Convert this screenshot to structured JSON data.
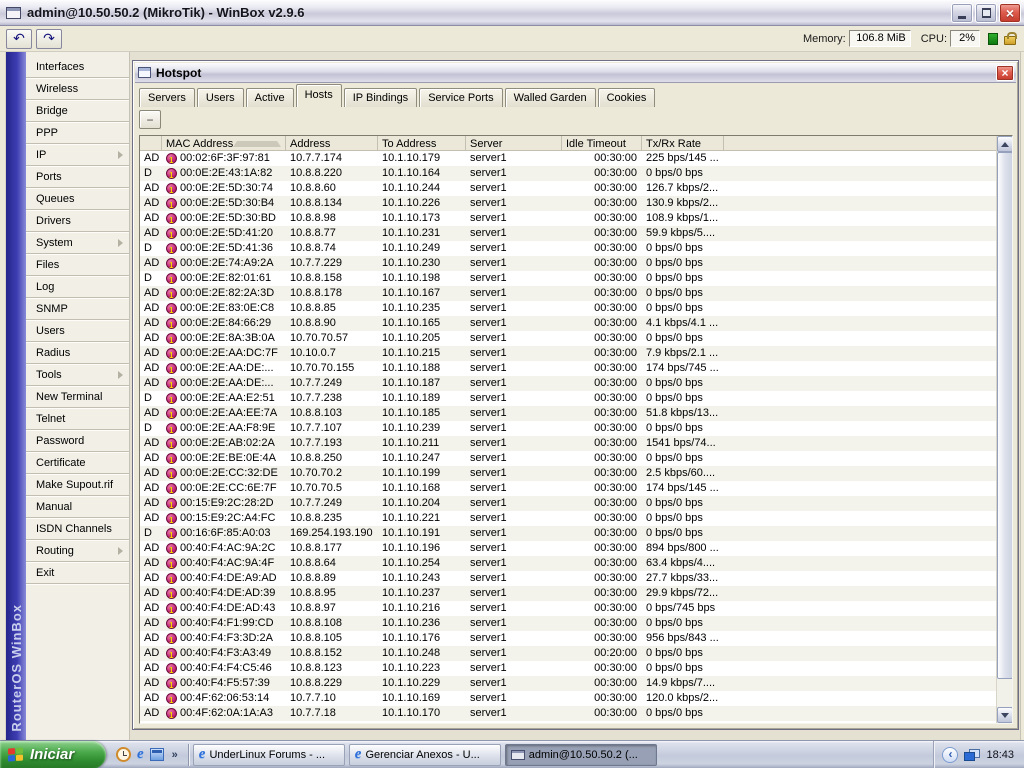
{
  "titlebar": {
    "title": "admin@10.50.50.2 (MikroTik) - WinBox v2.9.6"
  },
  "toolbar": {
    "memory_label": "Memory:",
    "memory_value": "106.8 MiB",
    "cpu_label": "CPU:",
    "cpu_value": "2%"
  },
  "icons": {
    "undo": "↶",
    "redo": "↷",
    "close": "×",
    "remove": "−",
    "overflow": "»",
    "tray_collapse": "‹"
  },
  "colors": {
    "accent_blue": "#3d3db2",
    "start_green": "#2f8c2f",
    "host_icon_pink": "#c02070",
    "close_red": "#c43a2c"
  },
  "sidebar": {
    "brand": "RouterOS WinBox",
    "items": [
      {
        "label": "Interfaces",
        "submenu": false
      },
      {
        "label": "Wireless",
        "submenu": false
      },
      {
        "label": "Bridge",
        "submenu": false
      },
      {
        "label": "PPP",
        "submenu": false
      },
      {
        "label": "IP",
        "submenu": true
      },
      {
        "label": "Ports",
        "submenu": false
      },
      {
        "label": "Queues",
        "submenu": false
      },
      {
        "label": "Drivers",
        "submenu": false
      },
      {
        "label": "System",
        "submenu": true
      },
      {
        "label": "Files",
        "submenu": false
      },
      {
        "label": "Log",
        "submenu": false
      },
      {
        "label": "SNMP",
        "submenu": false
      },
      {
        "label": "Users",
        "submenu": false
      },
      {
        "label": "Radius",
        "submenu": false
      },
      {
        "label": "Tools",
        "submenu": true
      },
      {
        "label": "New Terminal",
        "submenu": false
      },
      {
        "label": "Telnet",
        "submenu": false
      },
      {
        "label": "Password",
        "submenu": false
      },
      {
        "label": "Certificate",
        "submenu": false
      },
      {
        "label": "Make Supout.rif",
        "submenu": false
      },
      {
        "label": "Manual",
        "submenu": false
      },
      {
        "label": "ISDN Channels",
        "submenu": false
      },
      {
        "label": "Routing",
        "submenu": true
      },
      {
        "label": "Exit",
        "submenu": false
      }
    ]
  },
  "hotspot": {
    "title": "Hotspot",
    "tabs": [
      "Servers",
      "Users",
      "Active",
      "Hosts",
      "IP Bindings",
      "Service Ports",
      "Walled Garden",
      "Cookies"
    ],
    "active_tab": "Hosts",
    "table": {
      "columns": [
        "",
        "MAC Address",
        "Address",
        "To Address",
        "Server",
        "Idle Timeout",
        "Tx/Rx Rate"
      ],
      "sorted_column": "MAC Address",
      "rows": [
        [
          "AD",
          "00:02:6F:3F:97:81",
          "10.7.7.174",
          "10.1.10.179",
          "server1",
          "00:30:00",
          "225 bps/145 ..."
        ],
        [
          "D",
          "00:0E:2E:43:1A:82",
          "10.8.8.220",
          "10.1.10.164",
          "server1",
          "00:30:00",
          "0 bps/0 bps"
        ],
        [
          "AD",
          "00:0E:2E:5D:30:74",
          "10.8.8.60",
          "10.1.10.244",
          "server1",
          "00:30:00",
          "126.7 kbps/2..."
        ],
        [
          "AD",
          "00:0E:2E:5D:30:B4",
          "10.8.8.134",
          "10.1.10.226",
          "server1",
          "00:30:00",
          "130.9 kbps/2..."
        ],
        [
          "AD",
          "00:0E:2E:5D:30:BD",
          "10.8.8.98",
          "10.1.10.173",
          "server1",
          "00:30:00",
          "108.9 kbps/1..."
        ],
        [
          "AD",
          "00:0E:2E:5D:41:20",
          "10.8.8.77",
          "10.1.10.231",
          "server1",
          "00:30:00",
          "59.9 kbps/5...."
        ],
        [
          "D",
          "00:0E:2E:5D:41:36",
          "10.8.8.74",
          "10.1.10.249",
          "server1",
          "00:30:00",
          "0 bps/0 bps"
        ],
        [
          "AD",
          "00:0E:2E:74:A9:2A",
          "10.7.7.229",
          "10.1.10.230",
          "server1",
          "00:30:00",
          "0 bps/0 bps"
        ],
        [
          "D",
          "00:0E:2E:82:01:61",
          "10.8.8.158",
          "10.1.10.198",
          "server1",
          "00:30:00",
          "0 bps/0 bps"
        ],
        [
          "AD",
          "00:0E:2E:82:2A:3D",
          "10.8.8.178",
          "10.1.10.167",
          "server1",
          "00:30:00",
          "0 bps/0 bps"
        ],
        [
          "AD",
          "00:0E:2E:83:0E:C8",
          "10.8.8.85",
          "10.1.10.235",
          "server1",
          "00:30:00",
          "0 bps/0 bps"
        ],
        [
          "AD",
          "00:0E:2E:84:66:29",
          "10.8.8.90",
          "10.1.10.165",
          "server1",
          "00:30:00",
          "4.1 kbps/4.1 ..."
        ],
        [
          "AD",
          "00:0E:2E:8A:3B:0A",
          "10.70.70.57",
          "10.1.10.205",
          "server1",
          "00:30:00",
          "0 bps/0 bps"
        ],
        [
          "AD",
          "00:0E:2E:AA:DC:7F",
          "10.10.0.7",
          "10.1.10.215",
          "server1",
          "00:30:00",
          "7.9 kbps/2.1 ..."
        ],
        [
          "AD",
          "00:0E:2E:AA:DE:...",
          "10.70.70.155",
          "10.1.10.188",
          "server1",
          "00:30:00",
          "174 bps/745 ..."
        ],
        [
          "AD",
          "00:0E:2E:AA:DE:...",
          "10.7.7.249",
          "10.1.10.187",
          "server1",
          "00:30:00",
          "0 bps/0 bps"
        ],
        [
          "D",
          "00:0E:2E:AA:E2:51",
          "10.7.7.238",
          "10.1.10.189",
          "server1",
          "00:30:00",
          "0 bps/0 bps"
        ],
        [
          "AD",
          "00:0E:2E:AA:EE:7A",
          "10.8.8.103",
          "10.1.10.185",
          "server1",
          "00:30:00",
          "51.8 kbps/13..."
        ],
        [
          "D",
          "00:0E:2E:AA:F8:9E",
          "10.7.7.107",
          "10.1.10.239",
          "server1",
          "00:30:00",
          "0 bps/0 bps"
        ],
        [
          "AD",
          "00:0E:2E:AB:02:2A",
          "10.7.7.193",
          "10.1.10.211",
          "server1",
          "00:30:00",
          "1541 bps/74..."
        ],
        [
          "AD",
          "00:0E:2E:BE:0E:4A",
          "10.8.8.250",
          "10.1.10.247",
          "server1",
          "00:30:00",
          "0 bps/0 bps"
        ],
        [
          "AD",
          "00:0E:2E:CC:32:DE",
          "10.70.70.2",
          "10.1.10.199",
          "server1",
          "00:30:00",
          "2.5 kbps/60...."
        ],
        [
          "AD",
          "00:0E:2E:CC:6E:7F",
          "10.70.70.5",
          "10.1.10.168",
          "server1",
          "00:30:00",
          "174 bps/145 ..."
        ],
        [
          "AD",
          "00:15:E9:2C:28:2D",
          "10.7.7.249",
          "10.1.10.204",
          "server1",
          "00:30:00",
          "0 bps/0 bps"
        ],
        [
          "AD",
          "00:15:E9:2C:A4:FC",
          "10.8.8.235",
          "10.1.10.221",
          "server1",
          "00:30:00",
          "0 bps/0 bps"
        ],
        [
          "D",
          "00:16:6F:85:A0:03",
          "169.254.193.190",
          "10.1.10.191",
          "server1",
          "00:30:00",
          "0 bps/0 bps"
        ],
        [
          "AD",
          "00:40:F4:AC:9A:2C",
          "10.8.8.177",
          "10.1.10.196",
          "server1",
          "00:30:00",
          "894 bps/800 ..."
        ],
        [
          "AD",
          "00:40:F4:AC:9A:4F",
          "10.8.8.64",
          "10.1.10.254",
          "server1",
          "00:30:00",
          "63.4 kbps/4...."
        ],
        [
          "AD",
          "00:40:F4:DE:A9:AD",
          "10.8.8.89",
          "10.1.10.243",
          "server1",
          "00:30:00",
          "27.7 kbps/33..."
        ],
        [
          "AD",
          "00:40:F4:DE:AD:39",
          "10.8.8.95",
          "10.1.10.237",
          "server1",
          "00:30:00",
          "29.9 kbps/72..."
        ],
        [
          "AD",
          "00:40:F4:DE:AD:43",
          "10.8.8.97",
          "10.1.10.216",
          "server1",
          "00:30:00",
          "0 bps/745 bps"
        ],
        [
          "AD",
          "00:40:F4:F1:99:CD",
          "10.8.8.108",
          "10.1.10.236",
          "server1",
          "00:30:00",
          "0 bps/0 bps"
        ],
        [
          "AD",
          "00:40:F4:F3:3D:2A",
          "10.8.8.105",
          "10.1.10.176",
          "server1",
          "00:30:00",
          "956 bps/843 ..."
        ],
        [
          "AD",
          "00:40:F4:F3:A3:49",
          "10.8.8.152",
          "10.1.10.248",
          "server1",
          "00:20:00",
          "0 bps/0 bps"
        ],
        [
          "AD",
          "00:40:F4:F4:C5:46",
          "10.8.8.123",
          "10.1.10.223",
          "server1",
          "00:30:00",
          "0 bps/0 bps"
        ],
        [
          "AD",
          "00:40:F4:F5:57:39",
          "10.8.8.229",
          "10.1.10.229",
          "server1",
          "00:30:00",
          "14.9 kbps/7...."
        ],
        [
          "AD",
          "00:4F:62:06:53:14",
          "10.7.7.10",
          "10.1.10.169",
          "server1",
          "00:30:00",
          "120.0 kbps/2..."
        ],
        [
          "AD",
          "00:4F:62:0A:1A:A3",
          "10.7.7.18",
          "10.1.10.170",
          "server1",
          "00:30:00",
          "0 bps/0 bps"
        ]
      ]
    }
  },
  "taskbar": {
    "start_label": "Iniciar",
    "buttons": [
      {
        "label": "UnderLinux Forums - ...",
        "icon": "ie",
        "active": false
      },
      {
        "label": "Gerenciar Anexos - U...",
        "icon": "ie",
        "active": false
      },
      {
        "label": "admin@10.50.50.2 (...",
        "icon": "winbox",
        "active": true
      }
    ],
    "tray": {
      "time": "18:43"
    }
  }
}
